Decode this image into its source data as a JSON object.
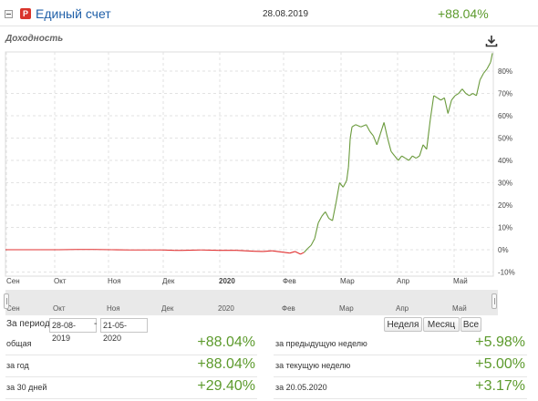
{
  "header": {
    "logo_letter": "P",
    "title": "Единый счет",
    "date": "28.08.2019",
    "return_pct": "+88.04%"
  },
  "chart_label": "Доходность",
  "chart_data": {
    "type": "line",
    "x_axis_labels": [
      "Сен",
      "Окт",
      "Ноя",
      "Дек",
      "2020",
      "Фев",
      "Мар",
      "Апр",
      "Май"
    ],
    "y_axis_labels": [
      "80%",
      "70%",
      "60%",
      "50%",
      "40%",
      "30%",
      "20%",
      "10%",
      "0%",
      "-10%"
    ],
    "ylim": [
      -10,
      90
    ],
    "colors": {
      "negative": "#e02f2f",
      "positive": "#6a9a3c"
    },
    "series": [
      {
        "x_unit": "days since 2019-08-28",
        "values_pct": [
          [
            0,
            0
          ],
          [
            10,
            0
          ],
          [
            20,
            0
          ],
          [
            30,
            0
          ],
          [
            40,
            0.1
          ],
          [
            50,
            0.1
          ],
          [
            60,
            0
          ],
          [
            70,
            -0.1
          ],
          [
            80,
            -0.1
          ],
          [
            88,
            -0.1
          ],
          [
            95,
            -0.3
          ],
          [
            100,
            -0.3
          ],
          [
            110,
            -0.1
          ],
          [
            120,
            -0.3
          ],
          [
            130,
            -0.3
          ],
          [
            140,
            -0.7
          ],
          [
            145,
            -0.8
          ],
          [
            150,
            -0.5
          ],
          [
            155,
            -1.0
          ],
          [
            160,
            -1.5
          ],
          [
            163,
            -0.8
          ],
          [
            166,
            -2.0
          ],
          [
            168,
            -1.2
          ],
          [
            170,
            0.5
          ],
          [
            172,
            2.0
          ],
          [
            174,
            5.0
          ],
          [
            176,
            12.0
          ],
          [
            178,
            15.0
          ],
          [
            180,
            17.0
          ],
          [
            182,
            14.0
          ],
          [
            184,
            13.0
          ],
          [
            186,
            21.0
          ],
          [
            188,
            30.0
          ],
          [
            190,
            28.0
          ],
          [
            192,
            31.0
          ],
          [
            193,
            37.0
          ],
          [
            194,
            50.0
          ],
          [
            195,
            55.0
          ],
          [
            197,
            56.0
          ],
          [
            200,
            55.0
          ],
          [
            203,
            56.0
          ],
          [
            205,
            53.0
          ],
          [
            207,
            51.0
          ],
          [
            209,
            47.0
          ],
          [
            211,
            52.0
          ],
          [
            213,
            57.0
          ],
          [
            215,
            50.0
          ],
          [
            217,
            44.0
          ],
          [
            219,
            42.0
          ],
          [
            221,
            40.0
          ],
          [
            223,
            42.0
          ],
          [
            225,
            41.0
          ],
          [
            227,
            40.0
          ],
          [
            229,
            42.0
          ],
          [
            231,
            41.0
          ],
          [
            233,
            42.0
          ],
          [
            235,
            47.0
          ],
          [
            237,
            45.0
          ],
          [
            239,
            58.0
          ],
          [
            241,
            69.0
          ],
          [
            243,
            68.0
          ],
          [
            245,
            67.0
          ],
          [
            247,
            68.0
          ],
          [
            249,
            61.0
          ],
          [
            251,
            67.0
          ],
          [
            253,
            69.0
          ],
          [
            255,
            70.0
          ],
          [
            257,
            72.0
          ],
          [
            259,
            70.0
          ],
          [
            261,
            69.0
          ],
          [
            263,
            70.0
          ],
          [
            265,
            69.0
          ],
          [
            267,
            76.0
          ],
          [
            269,
            79.0
          ],
          [
            271,
            81.0
          ],
          [
            273,
            84.0
          ],
          [
            274,
            88.0
          ]
        ]
      }
    ]
  },
  "navigator": {
    "tick_labels": [
      "Сен",
      "Окт",
      "Ноя",
      "Дек",
      "2020",
      "Фев",
      "Мар",
      "Апр",
      "Май"
    ]
  },
  "period": {
    "label": "За период:",
    "from": "28-08-2019",
    "separator": "-",
    "to": "21-05-2020"
  },
  "range_buttons": [
    "Неделя",
    "Месяц",
    "Все"
  ],
  "stats_left": [
    {
      "label": "общая",
      "value": "+88.04%"
    },
    {
      "label": "за год",
      "value": "+88.04%"
    },
    {
      "label": "за 30 дней",
      "value": "+29.40%"
    }
  ],
  "stats_right": [
    {
      "label": "за предыдущую неделю",
      "value": "+5.98%"
    },
    {
      "label": "за текущую неделю",
      "value": "+5.00%"
    },
    {
      "label": "за 20.05.2020",
      "value": "+3.17%"
    }
  ]
}
